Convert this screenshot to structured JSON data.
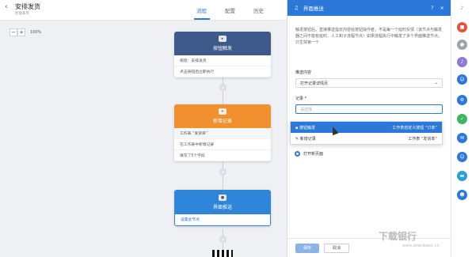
{
  "header": {
    "back_icon": "back-arrow-icon",
    "title": "安排发货",
    "subtitle": "智能表单",
    "tabs": [
      {
        "label": "流程"
      },
      {
        "label": "配置"
      },
      {
        "label": "历史"
      }
    ],
    "active_tab": "流程"
  },
  "zoom": {
    "minus": "−",
    "plus": "+",
    "value": "100%"
  },
  "nodes": [
    {
      "title": "按钮触发",
      "color": "#3d5a8a",
      "lines": [
        "按钮：安排发货",
        "点击按钮后立即执行"
      ]
    },
    {
      "title": "新增记录",
      "color": "#f0902f",
      "lines": [
        "工作表 “发货单”",
        "在工作表中新增记录",
        "填写了5个字段"
      ]
    },
    {
      "title": "界面推送",
      "color": "#2f86d9",
      "lines": [
        "设置此节点"
      ]
    }
  ],
  "panel": {
    "title": "界面推送",
    "help": "?",
    "close": "×",
    "desc": "触发按钮后，直接推送指定内容给按钮操作者，不是每一个延时反馈（该节点与触发器之间不能有延时、人工和子流程节点）如果流程执行中触发了多个界面推送节点，只生效第一个",
    "push_label": "推送内容",
    "push_value": "打开记录详情页",
    "record_label": "记录 *",
    "record_placeholder": "请选择",
    "options": [
      {
        "left": "按钮触发",
        "right": "工作表自定义按钮 “订单”"
      },
      {
        "left": "新增记录",
        "right": "工作表 “发货单”"
      }
    ],
    "radio_label": "打开新页面",
    "save": "保存",
    "cancel": "取消"
  },
  "rail_icons": [
    {
      "name": "bell-icon",
      "color": "#888"
    },
    {
      "name": "app-red-icon",
      "color": "#e5533d"
    },
    {
      "name": "user-icon",
      "color": "#9aa5b1"
    },
    {
      "name": "notify-icon",
      "color": "#8f7ad6"
    },
    {
      "name": "group-icon",
      "color": "#2b78d9"
    },
    {
      "name": "workflow-icon",
      "color": "#2b78d9"
    },
    {
      "name": "check-icon",
      "color": "#3fb55f"
    },
    {
      "name": "chat-icon",
      "color": "#2b78d9"
    },
    {
      "name": "people-icon",
      "color": "#2b78d9"
    },
    {
      "name": "folder-icon",
      "color": "#2b9fd9"
    },
    {
      "name": "team-icon",
      "color": "#2b78d9"
    }
  ],
  "watermark": {
    "main": "下载银行",
    "sub": "www.downbank.cn"
  }
}
